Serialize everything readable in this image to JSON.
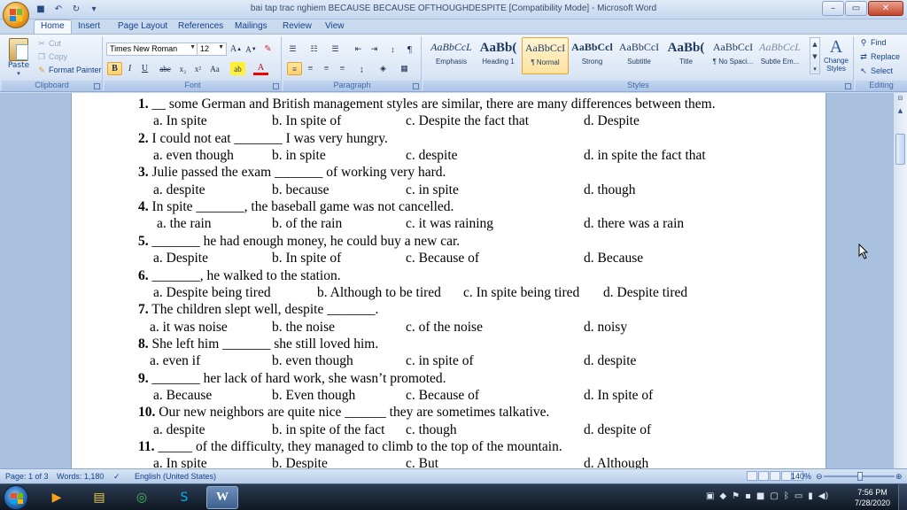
{
  "window": {
    "title": "bai tap  trac nghiem BECAUSE BECAUSE OFTHOUGHDESPITE [Compatibility Mode] - Microsoft Word",
    "min": "–",
    "max": "▭",
    "close": "✕"
  },
  "tabs": [
    {
      "label": "Home"
    },
    {
      "label": "Insert"
    },
    {
      "label": "Page Layout"
    },
    {
      "label": "References"
    },
    {
      "label": "Mailings"
    },
    {
      "label": "Review"
    },
    {
      "label": "View"
    }
  ],
  "clipboard": {
    "paste": "Paste",
    "cut": "Cut",
    "copy": "Copy",
    "format_painter": "Format Painter",
    "label": "Clipboard"
  },
  "font": {
    "name": "Times New Roman",
    "size": "12",
    "label": "Font"
  },
  "paragraph": {
    "label": "Paragraph"
  },
  "styles": {
    "label": "Styles",
    "items": [
      {
        "sample": "AaBbCcL",
        "name": "Emphasis"
      },
      {
        "sample": "AaBb(",
        "name": "Heading 1"
      },
      {
        "sample": "AaBbCcI",
        "name": "¶ Normal"
      },
      {
        "sample": "AaBbCcl",
        "name": "Strong"
      },
      {
        "sample": "AaBbCcI",
        "name": "Subtitle"
      },
      {
        "sample": "AaBb(",
        "name": "Title"
      },
      {
        "sample": "AaBbCcI",
        "name": "¶ No Spaci..."
      },
      {
        "sample": "AaBbCcL",
        "name": "Subtle Em..."
      }
    ],
    "change_styles_1": "Change",
    "change_styles_2": "Styles"
  },
  "editing": {
    "find": "Find",
    "replace": "Replace",
    "select": "Select",
    "label": "Editing"
  },
  "questions": [
    {
      "num": "1.",
      "text": " __ some German and British management styles are similar, there are many differences between them.",
      "opts": [
        "a. In spite",
        "b. In spite of",
        "c. Despite the fact that",
        "d. Despite"
      ]
    },
    {
      "num": "2.",
      "text": " I could not eat _______ I was very hungry.",
      "opts": [
        "a. even though",
        "b. in spite",
        "c. despite",
        "d. in spite the fact that"
      ]
    },
    {
      "num": "3.",
      "text": " Julie passed the exam _______ of working very hard.",
      "opts": [
        "a. despite",
        "b. because",
        "c. in spite",
        "d. though"
      ]
    },
    {
      "num": "4.",
      "text": " In spite _______, the baseball game was not cancelled.",
      "opts": [
        "a. the rain",
        "b. of the rain",
        "c. it was raining",
        "d. there was a rain"
      ]
    },
    {
      "num": "5.",
      "text": " _______ he had enough money, he could buy a new car.",
      "opts": [
        "a. Despite",
        "b. In spite of",
        "c. Because of",
        "d. Because"
      ]
    },
    {
      "num": "6.",
      "text": " _______, he walked to the station.",
      "opts": [
        "a. Despite being tired",
        "b. Although to be tired",
        "c. In spite being tired",
        "d. Despite tired"
      ]
    },
    {
      "num": "7.",
      "text": " The children slept well, despite _______.",
      "opts": [
        "a. it was noise",
        "b. the noise",
        "c. of the noise",
        "d. noisy"
      ]
    },
    {
      "num": "8.",
      "text": " She left him _______ she still loved him.",
      "opts": [
        "a. even if",
        "b. even though",
        "c. in spite of",
        "d. despite"
      ]
    },
    {
      "num": "9.",
      "text": " _______ her lack of hard work, she wasn’t  promoted.",
      "opts": [
        "a. Because",
        "b. Even though",
        "c. Because of",
        "d. In spite of"
      ]
    },
    {
      "num": "10.",
      "text": " Our new neighbors are quite nice ______ they are sometimes talkative.",
      "opts": [
        "a. despite",
        "b. in spite of the fact",
        "c. though",
        "d. despite of"
      ]
    },
    {
      "num": "11.",
      "text": " _____ of the difficulty, they managed to climb to the top of the mountain.",
      "opts": [
        "a. In spite",
        "b. Despite",
        "c. But",
        "d. Although"
      ]
    }
  ],
  "status": {
    "page": "Page: 1 of 3",
    "words": "Words: 1,180",
    "language": "English (United States)",
    "zoom": "140%"
  },
  "taskbar": {
    "time": "7:56 PM",
    "date": "7/28/2020"
  }
}
